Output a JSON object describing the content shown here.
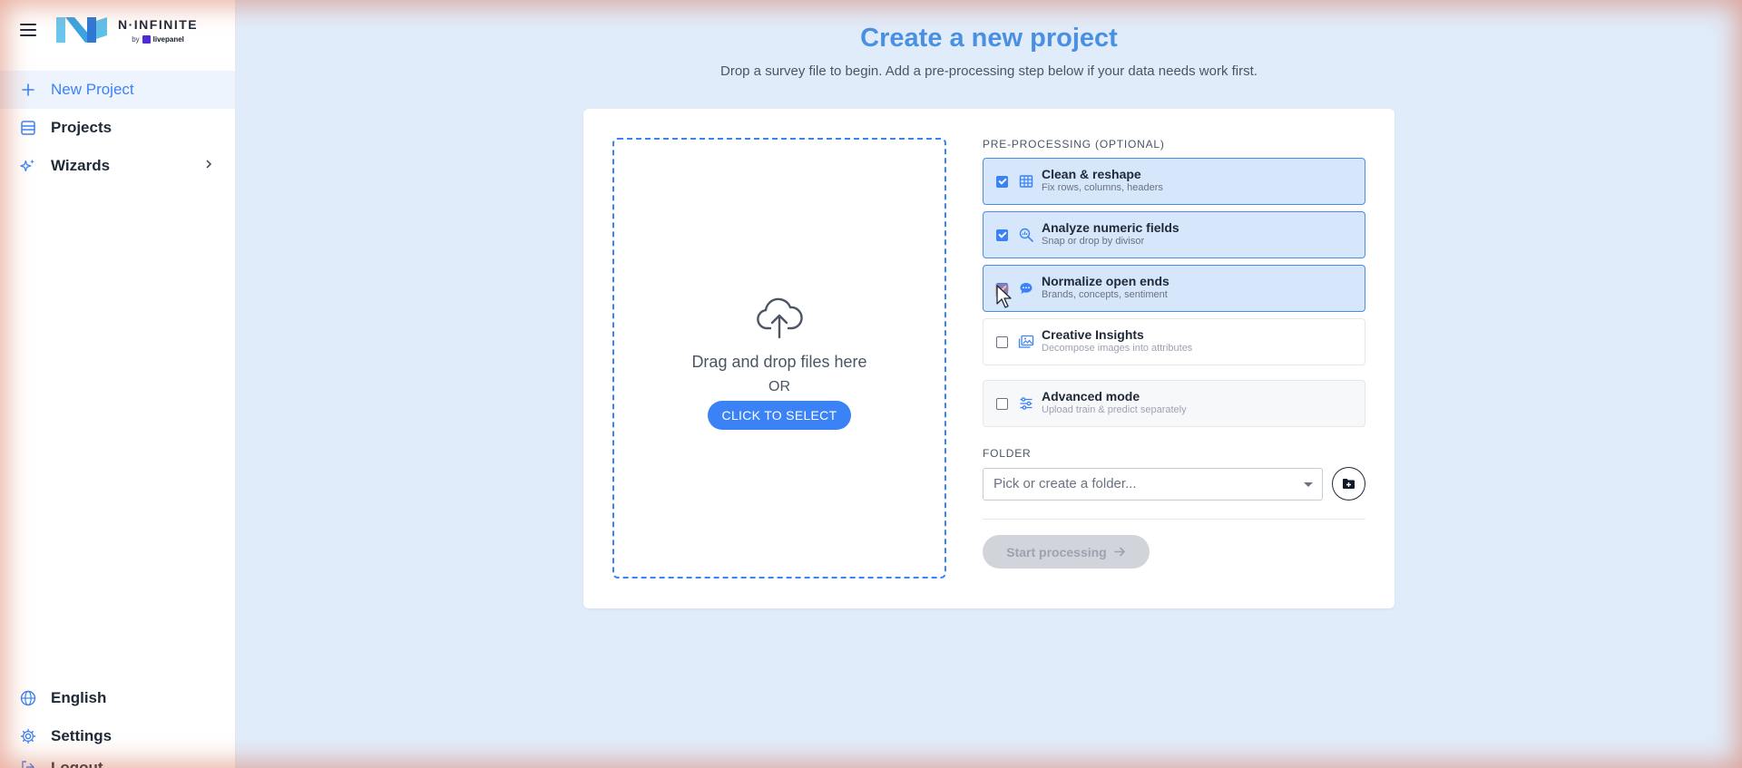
{
  "app": {
    "brand": "N·INFINITE",
    "brand_by": "by",
    "brand_partner": "livepanel"
  },
  "sidebar": {
    "items": [
      {
        "label": "New Project",
        "icon": "plus-icon",
        "active": true
      },
      {
        "label": "Projects",
        "icon": "list-icon",
        "active": false
      },
      {
        "label": "Wizards",
        "icon": "sparkles-icon",
        "active": false
      }
    ],
    "bottom_items": [
      {
        "label": "English",
        "icon": "globe-icon"
      },
      {
        "label": "Settings",
        "icon": "gear-icon"
      },
      {
        "label": "Logout",
        "icon": "logout-icon"
      }
    ]
  },
  "main": {
    "title": "Create a new project",
    "subtitle": "Drop a survey file to begin. Add a pre-processing step below if your data needs work first.",
    "dropzone": {
      "text": "Drag and drop files here",
      "or": "OR",
      "button": "CLICK TO SELECT"
    },
    "preprocessing": {
      "label": "PRE-PROCESSING (OPTIONAL)",
      "options": [
        {
          "title": "Clean & reshape",
          "desc": "Fix rows, columns, headers",
          "checked": true,
          "icon": "table-icon"
        },
        {
          "title": "Analyze numeric fields",
          "desc": "Snap or drop by divisor",
          "checked": true,
          "icon": "magnify-chart-icon"
        },
        {
          "title": "Normalize open ends",
          "desc": "Brands, concepts, sentiment",
          "checked": true,
          "icon": "chat-bubble-icon"
        },
        {
          "title": "Creative Insights",
          "desc": "Decompose images into attributes",
          "checked": false,
          "icon": "images-icon"
        }
      ],
      "advanced": {
        "title": "Advanced mode",
        "desc": "Upload train & predict separately",
        "checked": false,
        "icon": "sliders-icon"
      }
    },
    "folder": {
      "label": "FOLDER",
      "placeholder": "Pick or create a folder..."
    },
    "start_button": "Start processing"
  },
  "colors": {
    "accent": "#3b82f6",
    "title": "#4a90e2",
    "background": "#e1ecfb",
    "checked_bg": "#d6e6fb"
  }
}
